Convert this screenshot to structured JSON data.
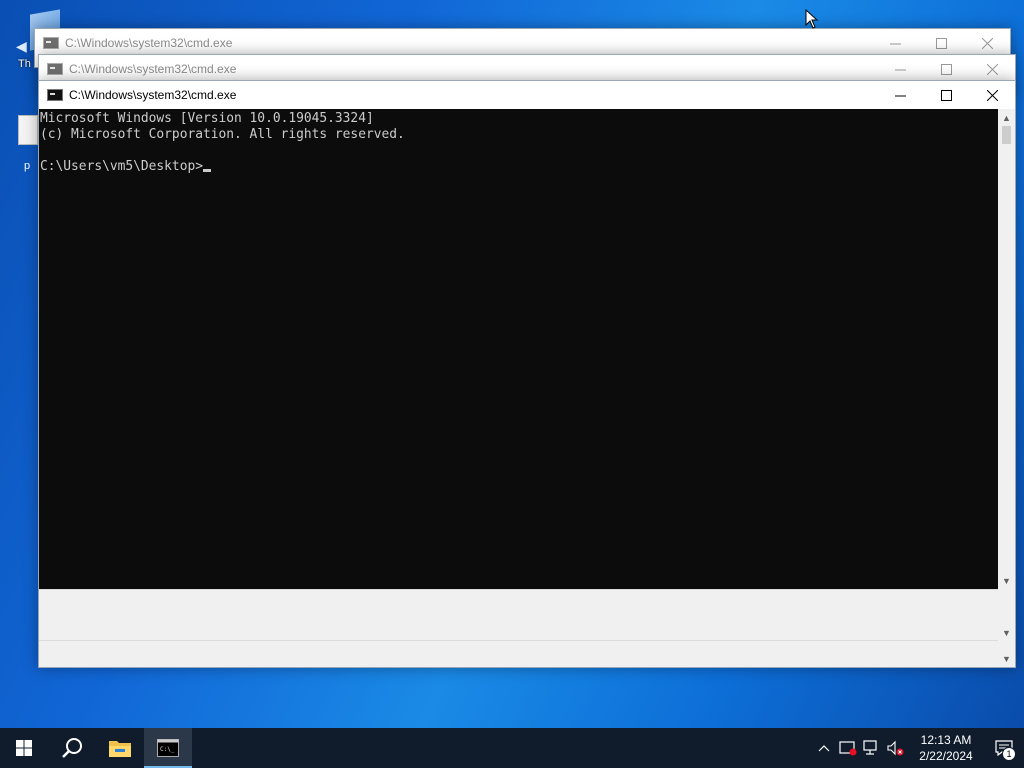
{
  "desktop": {
    "icon1_label": "Th",
    "icon2_label": "p"
  },
  "windows": {
    "back": {
      "title": "C:\\Windows\\system32\\cmd.exe"
    },
    "middle": {
      "title": "C:\\Windows\\system32\\cmd.exe"
    },
    "front": {
      "title": "C:\\Windows\\system32\\cmd.exe",
      "line1": "Microsoft Windows [Version 10.0.19045.3324]",
      "line2": "(c) Microsoft Corporation. All rights reserved.",
      "prompt": "C:\\Users\\vm5\\Desktop>"
    }
  },
  "taskbar": {
    "clock_time": "12:13 AM",
    "clock_date": "2/22/2024",
    "notification_count": "1"
  },
  "icons": [
    "windows-start-icon",
    "search-icon",
    "file-explorer-icon",
    "cmd-icon",
    "chevron-up-icon",
    "security-icon",
    "network-icon",
    "volume-muted-icon",
    "notification-icon",
    "minimize-icon",
    "maximize-icon",
    "close-icon"
  ]
}
